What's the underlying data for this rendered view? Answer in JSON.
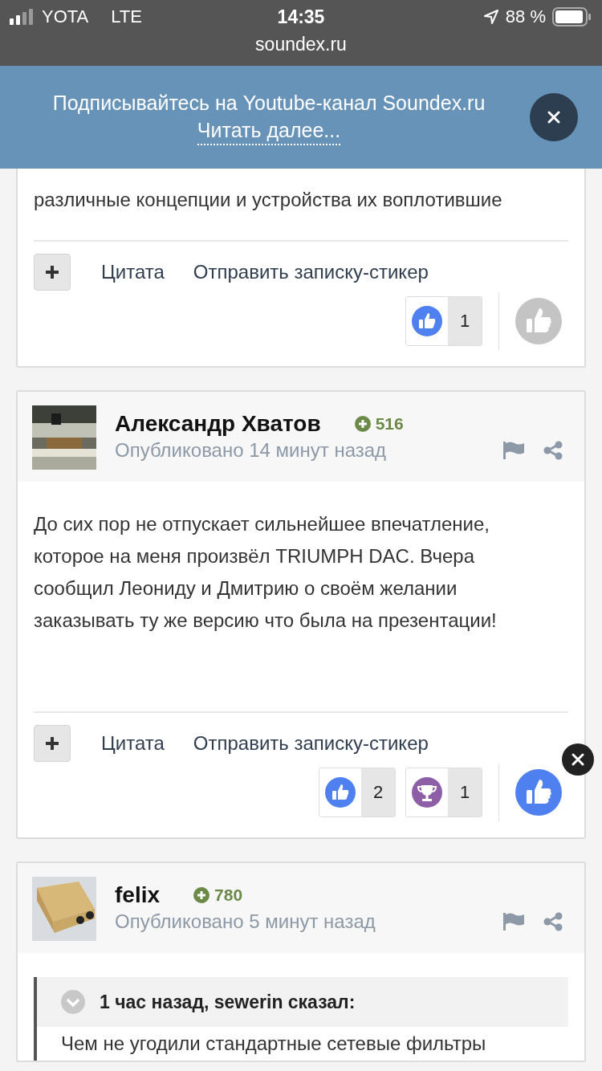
{
  "status_bar": {
    "carrier": "YOTA",
    "network": "LTE",
    "time": "14:35",
    "battery": "88 %",
    "url": "soundex.ru"
  },
  "banner": {
    "text": "Подписывайтесь на Youtube-канал Soundex.ru",
    "link": "Читать далее..."
  },
  "posts": [
    {
      "body": [
        "различные концепции и устройства их воплотившие"
      ],
      "actions": [
        "Цитата",
        "Отправить записку-стикер"
      ],
      "reactions": [
        {
          "kind": "like",
          "count": "1"
        }
      ],
      "reacted": false
    },
    {
      "author": "Александр Хватов",
      "reputation": "516",
      "posted": "Опубликовано 14 минут назад",
      "body": [
        "До сих пор не отпускает сильнейшее впечатление,",
        "которое на меня произвёл TRIUMPH DAC. Вчера",
        "сообщил Леониду и Дмитрию о своём желании",
        "заказывать ту же версию что была на презентации!"
      ],
      "actions": [
        "Цитата",
        "Отправить записку-стикер"
      ],
      "reactions": [
        {
          "kind": "like",
          "count": "2"
        },
        {
          "kind": "trophy",
          "count": "1"
        }
      ],
      "reacted": true
    },
    {
      "author": "felix",
      "reputation": "780",
      "posted": "Опубликовано 5 минут назад",
      "quote": {
        "header": "1 час назад, sewerin сказал:",
        "text": "Чем не угодили стандартные сетевые фильтры"
      }
    }
  ]
}
